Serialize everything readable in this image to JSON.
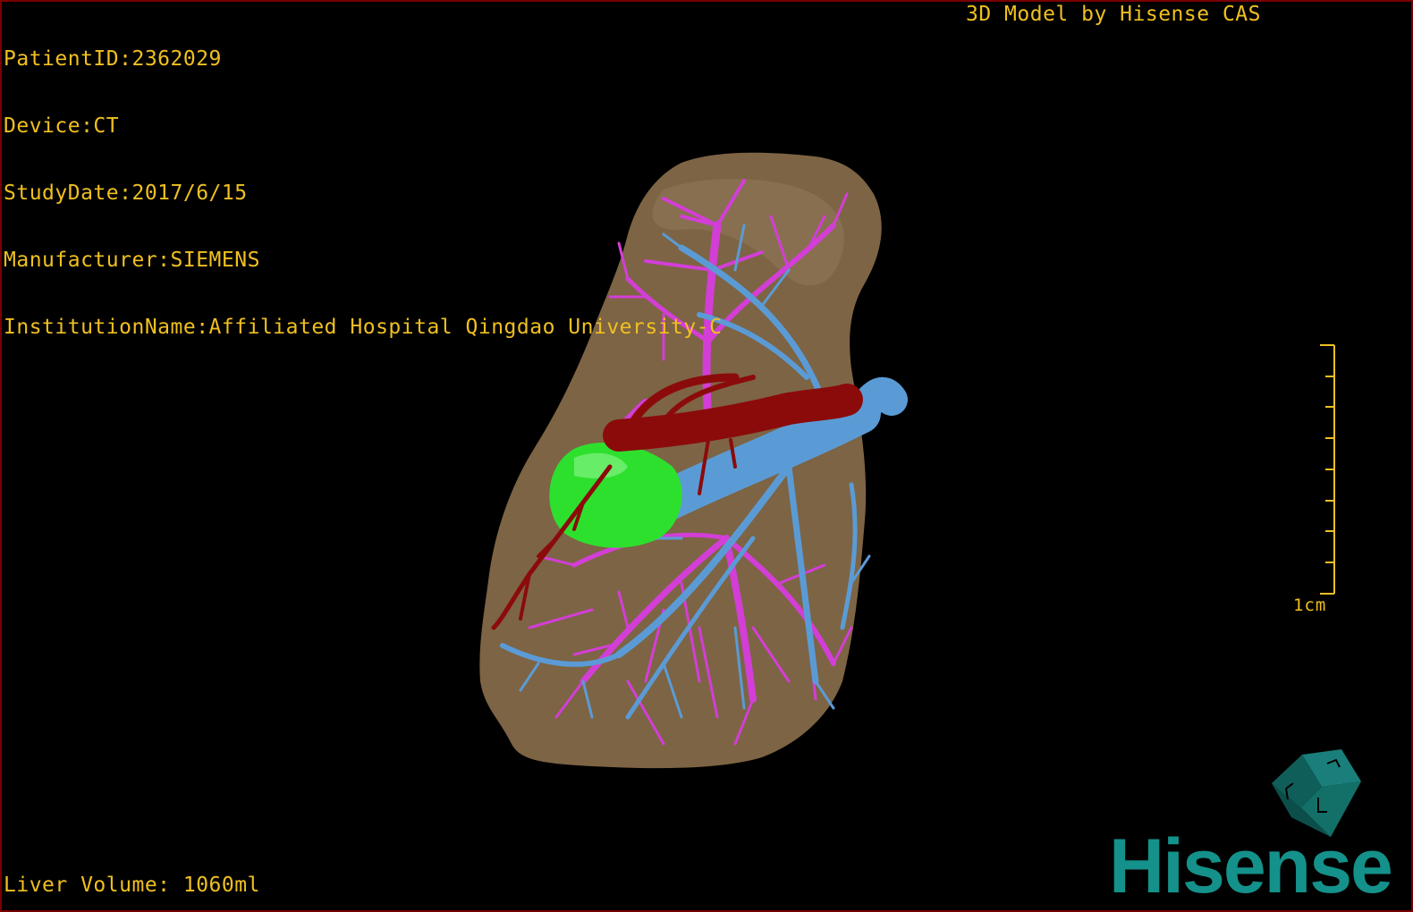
{
  "study_info": {
    "patient_id": "PatientID:2362029",
    "device": "Device:CT",
    "study_date": "StudyDate:2017/6/15",
    "manufacturer": "Manufacturer:SIEMENS",
    "institution": "InstitutionName:Affiliated Hospital Qingdao University-C"
  },
  "caption": "3D Model by Hisense CAS",
  "liver_volume": "Liver Volume: 1060ml",
  "scale": {
    "label": "1cm",
    "ticks": 9
  },
  "logo": {
    "text": "Hisense",
    "color": "#14918a"
  },
  "model_colors": {
    "liver": "#7d6444",
    "portal_vein": "#5b9bd5",
    "hepatic_vein": "#d23ed6",
    "artery": "#8b0b0b",
    "tumor": "#2ee02e",
    "text": "#f0c020"
  }
}
